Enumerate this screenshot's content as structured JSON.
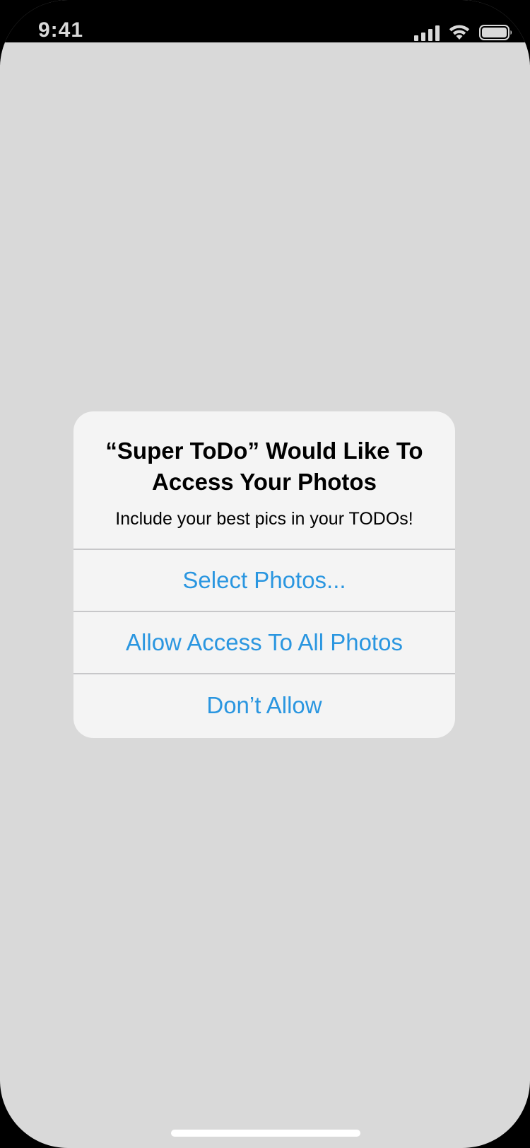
{
  "status_bar": {
    "time": "9:41",
    "icons": [
      "signal-icon",
      "wifi-icon",
      "battery-icon"
    ]
  },
  "alert": {
    "title": "“Super ToDo” Would Like To Access Your Photos",
    "message": "Include your best pics in your TODOs!",
    "buttons": [
      {
        "label": "Select Photos..."
      },
      {
        "label": "Allow Access To All Photos"
      },
      {
        "label": "Don’t Allow"
      }
    ]
  },
  "colors": {
    "background": "#d9d9d9",
    "alert_background": "#f4f4f4",
    "accent": "#2a96e0",
    "separator": "#c7c7c9"
  }
}
